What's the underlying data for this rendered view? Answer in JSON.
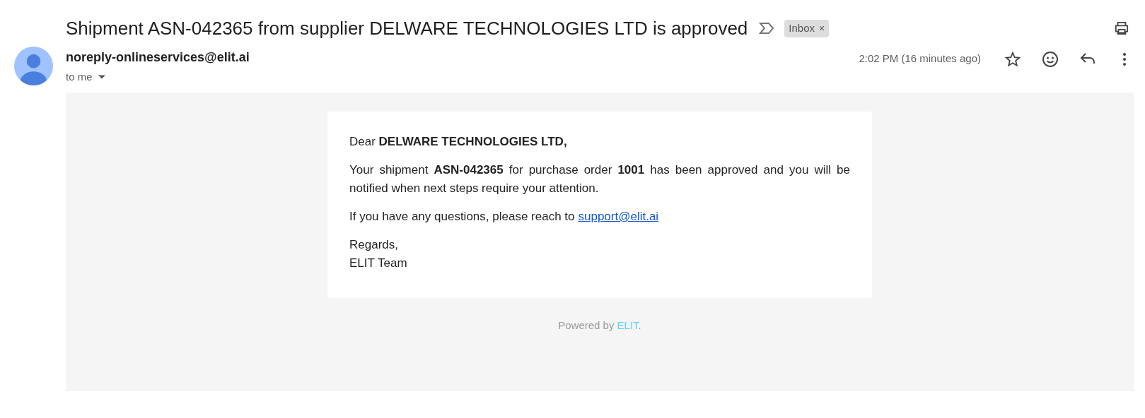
{
  "subject": "Shipment ASN-042365 from supplier DELWARE TECHNOLOGIES LTD is approved",
  "label": {
    "text": "Inbox",
    "close": "×"
  },
  "sender": {
    "email": "noreply-onlineservices@elit.ai",
    "recipient": "to me"
  },
  "time": "2:02 PM (16 minutes ago)",
  "starred": false,
  "body": {
    "greeting": "Dear **DELWARE TECHNOLOGIES LTD,**",
    "paragraphs": [
      "Your shipment **ASN-042365** for purchase order **1001** has been approved and you will be notified when next steps require your attention."
    ],
    "contact": {
      "text": "If you have any questions, please reach to",
      "link": "support@elit.ai"
    },
    "signoff": [
      "Regards,",
      "ELIT Team"
    ]
  },
  "footer": {
    "text": "Powered by",
    "brand": "ELIT",
    "suffix": "."
  }
}
